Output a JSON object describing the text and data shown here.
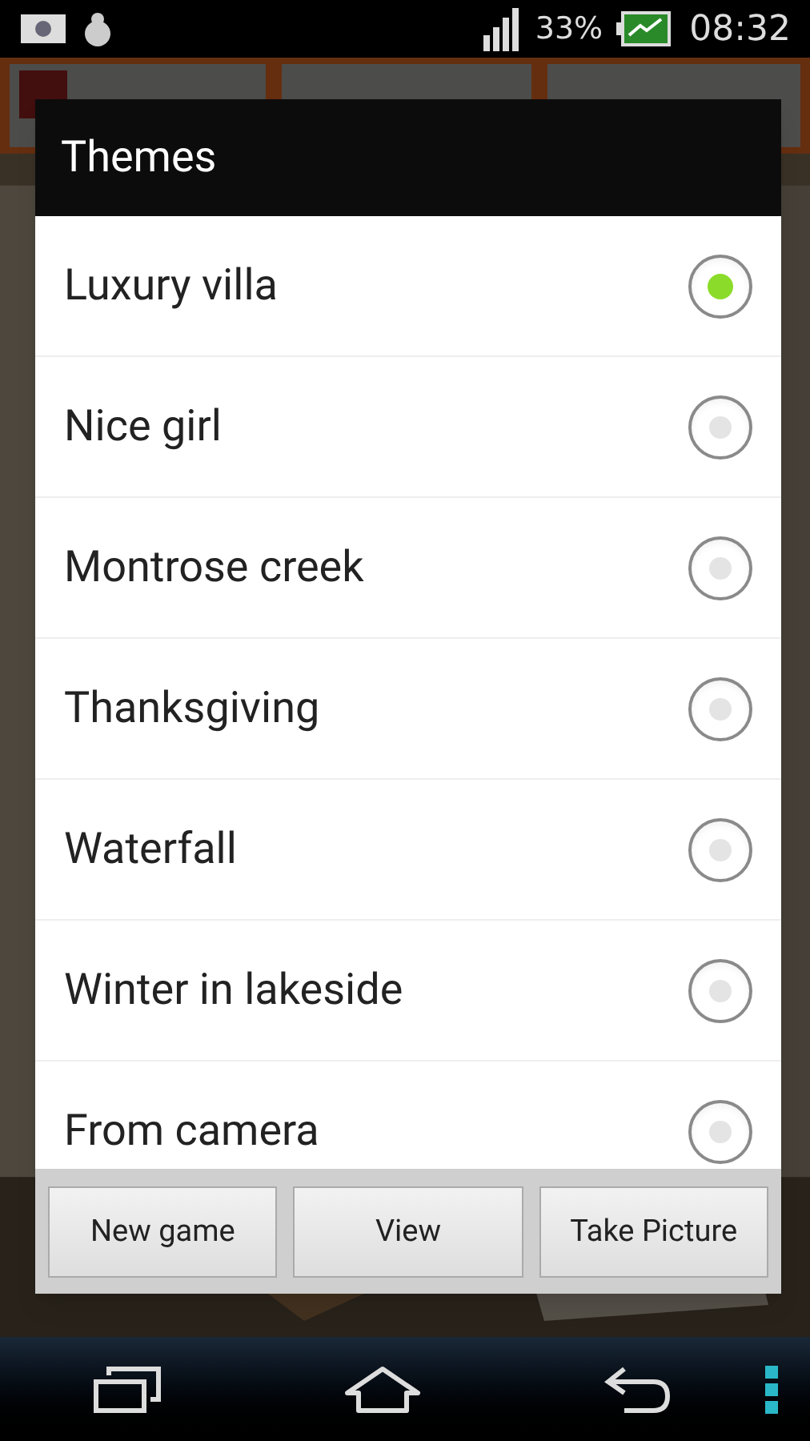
{
  "status_bar": {
    "battery": "33%",
    "time": "08:32"
  },
  "dialog": {
    "title": "Themes",
    "options": [
      {
        "label": "Luxury villa",
        "selected": true
      },
      {
        "label": "Nice girl",
        "selected": false
      },
      {
        "label": "Montrose creek",
        "selected": false
      },
      {
        "label": "Thanksgiving",
        "selected": false
      },
      {
        "label": "Waterfall",
        "selected": false
      },
      {
        "label": "Winter in lakeside",
        "selected": false
      },
      {
        "label": "From camera",
        "selected": false
      }
    ],
    "buttons": [
      "New game",
      "View",
      "Take Picture"
    ]
  }
}
